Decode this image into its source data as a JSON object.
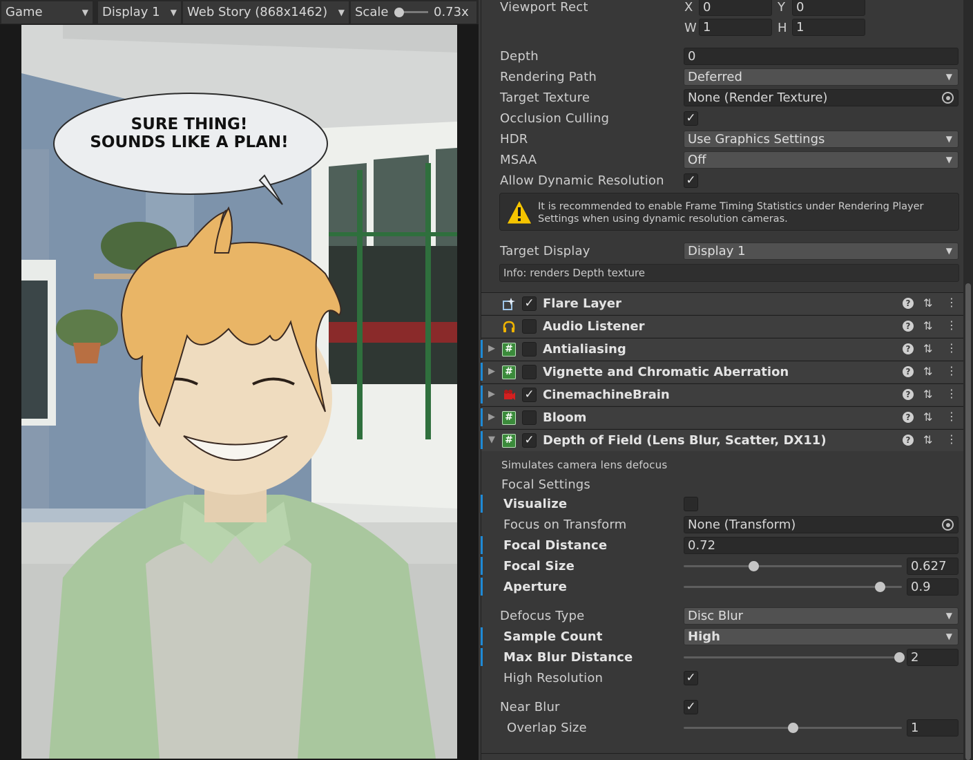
{
  "game_toolbar": {
    "view_label": "Game",
    "display_label": "Display 1",
    "resolution_label": "Web Story (868x1462)",
    "scale_label": "Scale",
    "scale_value": "0.73x",
    "scale_fraction": 0.1
  },
  "scene": {
    "speech_line1": "SURE THING!",
    "speech_line2": "SOUNDS LIKE A PLAN!"
  },
  "camera": {
    "viewport_rect_label": "Viewport Rect",
    "x_label": "X",
    "x_value": "0",
    "y_label": "Y",
    "y_value": "0",
    "w_label": "W",
    "w_value": "1",
    "h_label": "H",
    "h_value": "1",
    "depth_label": "Depth",
    "depth_value": "0",
    "rendering_path_label": "Rendering Path",
    "rendering_path_value": "Deferred",
    "target_texture_label": "Target Texture",
    "target_texture_value": "None (Render Texture)",
    "occlusion_culling_label": "Occlusion Culling",
    "occlusion_culling_checked": true,
    "hdr_label": "HDR",
    "hdr_value": "Use Graphics Settings",
    "msaa_label": "MSAA",
    "msaa_value": "Off",
    "dynamic_resolution_label": "Allow Dynamic Resolution",
    "dynamic_resolution_checked": true,
    "warning_text": "It is recommended to enable Frame Timing Statistics under Rendering Player Settings when using dynamic resolution cameras.",
    "target_display_label": "Target Display",
    "target_display_value": "Display 1",
    "info_text": "Info: renders Depth texture"
  },
  "components": [
    {
      "name": "Flare Layer",
      "enabled": true,
      "icon": "flare-layer-icon"
    },
    {
      "name": "Audio Listener",
      "enabled": false,
      "icon": "headphones-icon"
    },
    {
      "name": "Antialiasing",
      "enabled": false,
      "icon": "script-hash-icon"
    },
    {
      "name": "Vignette and Chromatic Aberration",
      "enabled": false,
      "icon": "script-hash-icon"
    },
    {
      "name": "CinemachineBrain",
      "enabled": true,
      "icon": "cinemachine-icon"
    },
    {
      "name": "Bloom",
      "enabled": false,
      "icon": "script-hash-icon"
    },
    {
      "name": "Depth of Field (Lens Blur, Scatter, DX11)",
      "enabled": true,
      "icon": "script-hash-icon"
    }
  ],
  "dof": {
    "description": "Simulates camera lens defocus",
    "focal_settings_label": "Focal Settings",
    "visualize_label": "Visualize",
    "visualize_checked": false,
    "focus_transform_label": "Focus on Transform",
    "focus_transform_value": "None (Transform)",
    "focal_distance_label": "Focal Distance",
    "focal_distance_value": "0.72",
    "focal_size_label": "Focal Size",
    "focal_size_value": "0.627",
    "focal_size_fraction": 0.32,
    "aperture_label": "Aperture",
    "aperture_value": "0.9",
    "aperture_fraction": 0.9,
    "defocus_type_label": "Defocus Type",
    "defocus_type_value": "Disc Blur",
    "sample_count_label": "Sample Count",
    "sample_count_value": "High",
    "max_blur_label": "Max Blur Distance",
    "max_blur_value": "2",
    "max_blur_fraction": 0.99,
    "high_res_label": "High Resolution",
    "high_res_checked": true,
    "near_blur_label": "Near Blur",
    "near_blur_checked": true,
    "overlap_size_label": "Overlap Size",
    "overlap_size_value": "1",
    "overlap_size_fraction": 0.5
  },
  "colors": {
    "accent_blue": "#1e8ad6",
    "script_icon_green": "#3b8b3b",
    "warning_yellow": "#f5c400"
  }
}
